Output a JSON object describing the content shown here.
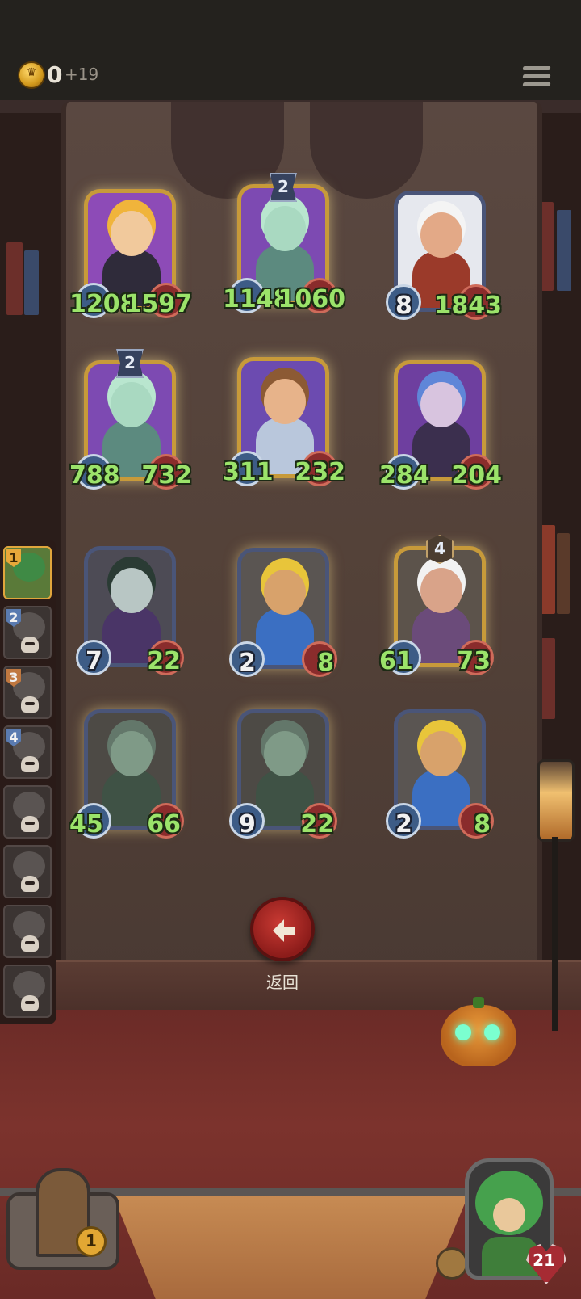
{
  "resources": {
    "gold": "0",
    "gold_income": "+19",
    "coin_icon": "crown-coin-icon"
  },
  "board": [
    {
      "name": "blonde-swordsman-card",
      "attack": "1208",
      "health": "1597",
      "level": "",
      "art": {
        "bg": "#8d4bb7",
        "hair": "#f0b43b",
        "skin": "#f1c99c",
        "body": "#2f2b3a"
      }
    },
    {
      "name": "ghost-horse-card",
      "attack": "1148",
      "health": "1060",
      "level": "2",
      "art": {
        "bg": "#7d4ab2",
        "hair": "#b9e6cf",
        "skin": "#a9d9c1",
        "body": "#5c8a7f"
      }
    },
    {
      "name": "old-warrior-card",
      "attack": "8",
      "health": "1843",
      "level": "",
      "art": {
        "bg": "#e6e8ee",
        "hair": "#f4f4f4",
        "skin": "#e3a987",
        "body": "#9b3a2a"
      }
    },
    {
      "name": "ghost-horse-card-2",
      "attack": "788",
      "health": "732",
      "level": "2",
      "art": {
        "bg": "#7d4ab2",
        "hair": "#b9e6cf",
        "skin": "#a9d9c1",
        "body": "#5c8a7f"
      }
    },
    {
      "name": "bearded-king-card",
      "attack": "311",
      "health": "232",
      "level": "",
      "art": {
        "bg": "#6c4bb0",
        "hair": "#8c5a34",
        "skin": "#e7b38a",
        "body": "#b9c7dc"
      }
    },
    {
      "name": "blue-hair-elf-card",
      "attack": "284",
      "health": "204",
      "level": "",
      "art": {
        "bg": "#6e3f9f",
        "hair": "#5f86d8",
        "skin": "#d8c4df",
        "body": "#3b2f4e"
      }
    },
    {
      "name": "horned-demon-card",
      "attack": "7",
      "health": "22",
      "level": "",
      "art": {
        "bg": "#4d4b55",
        "hair": "#2a3b34",
        "skin": "#b8c6c4",
        "body": "#4a3567"
      }
    },
    {
      "name": "pinocchio-card",
      "attack": "2",
      "health": "8",
      "level": "",
      "art": {
        "bg": "#5a5552",
        "hair": "#e8c53a",
        "skin": "#d8a26b",
        "body": "#3b6fc2"
      }
    },
    {
      "name": "old-dwarf-card",
      "attack": "61",
      "health": "73",
      "level": "4",
      "art": {
        "bg": "#5c534b",
        "hair": "#f2f2f2",
        "skin": "#d9a389",
        "body": "#6b4b7a"
      }
    },
    {
      "name": "swamp-monster-card",
      "attack": "45",
      "health": "66",
      "level": "",
      "art": {
        "bg": "#4d4a45",
        "hair": "#63776a",
        "skin": "#7f9a87",
        "body": "#3f5245"
      }
    },
    {
      "name": "swamp-monster-card-2",
      "attack": "9",
      "health": "22",
      "level": "",
      "art": {
        "bg": "#4d4a45",
        "hair": "#63776a",
        "skin": "#7f9a87",
        "body": "#3f5245"
      }
    },
    {
      "name": "pinocchio-card-2",
      "attack": "2",
      "health": "8",
      "level": "",
      "art": {
        "bg": "#5a5552",
        "hair": "#e8c53a",
        "skin": "#d8a26b",
        "body": "#3b6fc2"
      }
    }
  ],
  "hand": [
    {
      "num": "1",
      "active": true
    },
    {
      "num": "2",
      "active": false
    },
    {
      "num": "3",
      "active": false
    },
    {
      "num": "4",
      "active": false
    },
    {
      "num": "",
      "active": false
    },
    {
      "num": "",
      "active": false
    },
    {
      "num": "",
      "active": false
    },
    {
      "num": "",
      "active": false
    }
  ],
  "back_button": {
    "label": "返回",
    "icon": "arrow-left-icon"
  },
  "chest": {
    "count": "1"
  },
  "hero": {
    "health": "21"
  }
}
